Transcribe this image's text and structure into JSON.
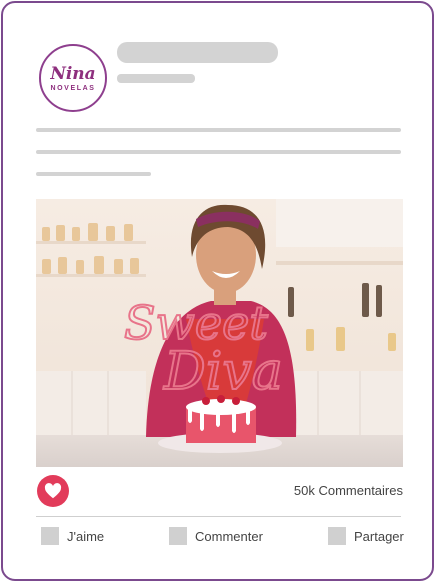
{
  "post": {
    "logo": {
      "word": "Nina",
      "sub": "NOVELAS"
    },
    "image": {
      "title_line1": "Sweet",
      "title_line2": "Diva",
      "alt": "Sweet Diva"
    },
    "comments_count": "50k Commentaires",
    "actions": {
      "like_label": "J'aime",
      "comment_label": "Commenter",
      "share_label": "Partager"
    }
  },
  "colors": {
    "border": "#7b4a8e",
    "brand": "#8e2f7e",
    "like": "#e23b5a",
    "placeholder": "#d3d3d3"
  }
}
